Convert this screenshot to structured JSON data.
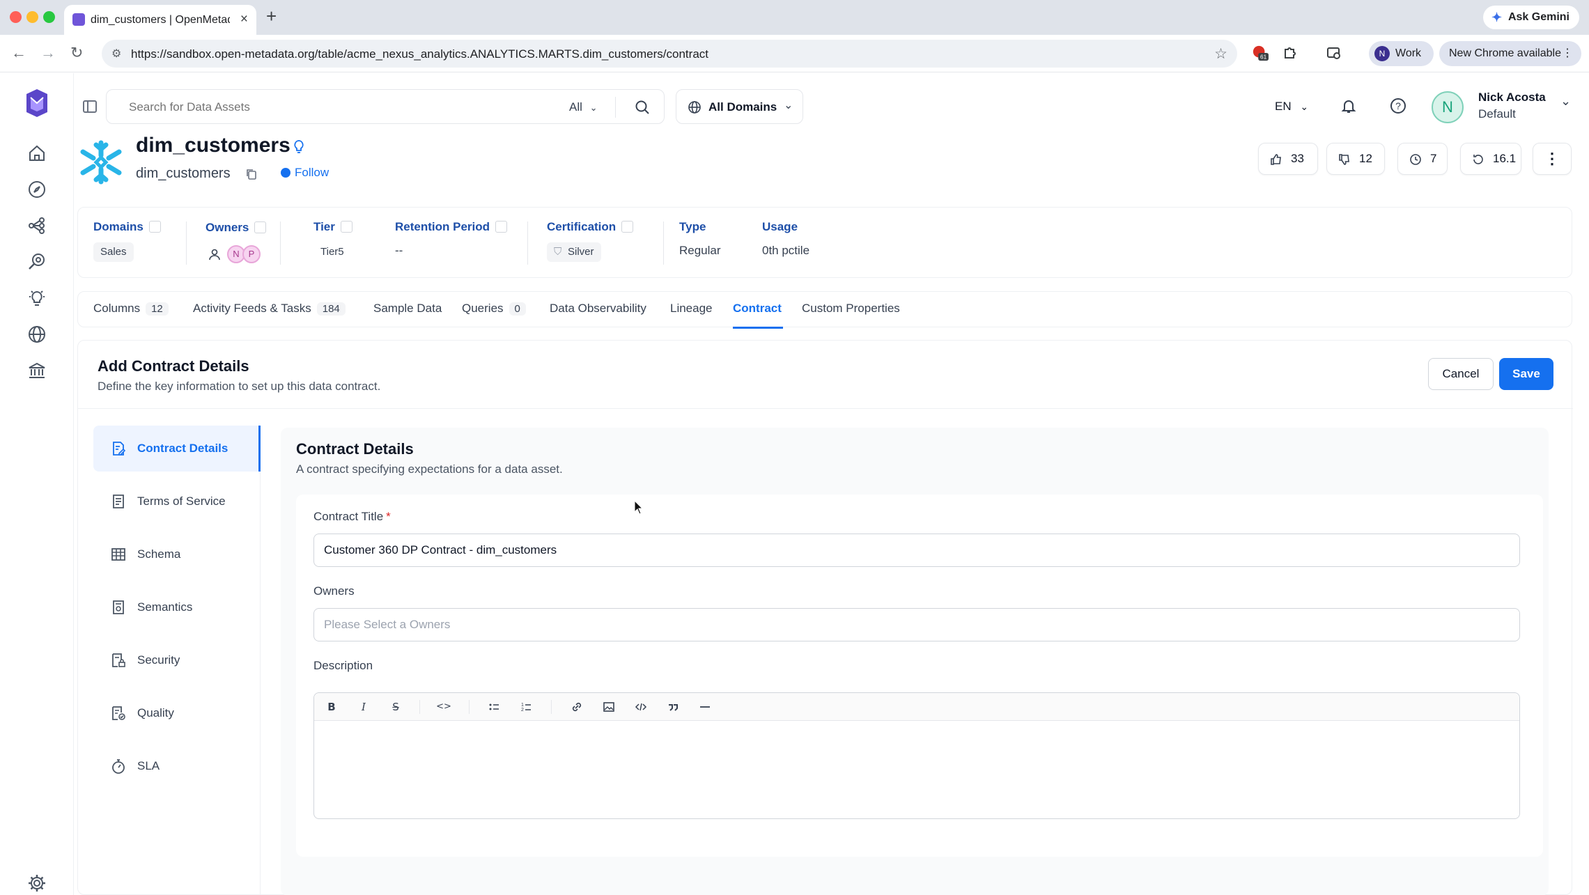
{
  "browser": {
    "tab_title": "dim_customers | OpenMetadata",
    "tab_close": "×",
    "new_tab": "+",
    "ask_gemini": "Ask Gemini",
    "url": "https://sandbox.open-metadata.org/table/acme_nexus_analytics.ANALYTICS.MARTS.dim_customers/contract",
    "profile_initial": "N",
    "profile_label": "Work",
    "update_label": "New Chrome available",
    "extension_badge": "61",
    "colors": {
      "close": "#ff5f57",
      "minimize": "#febc2e",
      "maximize": "#28c840"
    }
  },
  "header": {
    "search_placeholder": "Search for Data Assets",
    "search_scope": "All",
    "domain_selector": "All Domains",
    "language": "EN",
    "user_initial": "N",
    "user_name": "Nick Acosta",
    "user_role": "Default"
  },
  "entity": {
    "title": "dim_customers",
    "name": "dim_customers",
    "follow_label": "Follow",
    "stats": {
      "likes": "33",
      "dislikes": "12",
      "version_watch": "7",
      "version": "16.1"
    }
  },
  "metadata": {
    "domains_label": "Domains",
    "domains_value": "Sales",
    "owners_label": "Owners",
    "owner_avatars": [
      "N",
      "P"
    ],
    "tier_label": "Tier",
    "tier_value": "Tier5",
    "retention_label": "Retention Period",
    "retention_value": "--",
    "certification_label": "Certification",
    "certification_value": "Silver",
    "type_label": "Type",
    "type_value": "Regular",
    "usage_label": "Usage",
    "usage_value": "0th pctile"
  },
  "tabs": [
    {
      "label": "Columns",
      "count": "12"
    },
    {
      "label": "Activity Feeds & Tasks",
      "count": "184"
    },
    {
      "label": "Sample Data"
    },
    {
      "label": "Queries",
      "count": "0"
    },
    {
      "label": "Data Observability"
    },
    {
      "label": "Lineage"
    },
    {
      "label": "Contract",
      "active": true
    },
    {
      "label": "Custom Properties"
    }
  ],
  "contract": {
    "title": "Add Contract Details",
    "description": "Define the key information to set up this data contract.",
    "cancel_label": "Cancel",
    "save_label": "Save",
    "steps": [
      {
        "label": "Contract Details",
        "icon": "document-edit-icon",
        "active": true
      },
      {
        "label": "Terms of Service",
        "icon": "document-lines-icon"
      },
      {
        "label": "Schema",
        "icon": "table-grid-icon"
      },
      {
        "label": "Semantics",
        "icon": "semantics-doc-icon"
      },
      {
        "label": "Security",
        "icon": "security-doc-icon"
      },
      {
        "label": "Quality",
        "icon": "quality-doc-icon"
      },
      {
        "label": "SLA",
        "icon": "stopwatch-icon"
      }
    ],
    "form": {
      "heading": "Contract Details",
      "subheading": "A contract specifying expectations for a data asset.",
      "title_label": "Contract Title",
      "title_required": "*",
      "title_value": "Customer 360 DP Contract - dim_customers",
      "owners_label": "Owners",
      "owners_placeholder": "Please Select a Owners",
      "description_label": "Description",
      "editor_tools": [
        "B",
        "I",
        "S",
        "<>",
        "bullet-list",
        "numbered-list",
        "link",
        "image",
        "code-block",
        "quote",
        "divider"
      ]
    }
  },
  "theme": {
    "accent": "#1570ef",
    "heading": "#1e4fa8"
  }
}
